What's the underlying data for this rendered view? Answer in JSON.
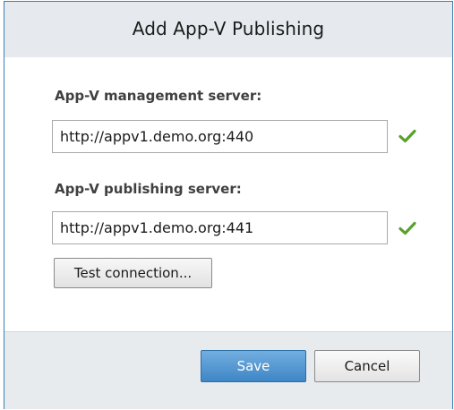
{
  "dialog": {
    "title": "Add App-V Publishing"
  },
  "management": {
    "label": "App-V management server:",
    "value": "http://appv1.demo.org:440",
    "status_icon": "check-icon",
    "status_color": "#5aa02c"
  },
  "publishing": {
    "label": "App-V publishing server:",
    "value": "http://appv1.demo.org:441",
    "status_icon": "check-icon",
    "status_color": "#5aa02c"
  },
  "actions": {
    "test_label": "Test connection...",
    "save_label": "Save",
    "cancel_label": "Cancel"
  },
  "colors": {
    "accent": "#3e86c6",
    "border": "#3c7fb1"
  }
}
